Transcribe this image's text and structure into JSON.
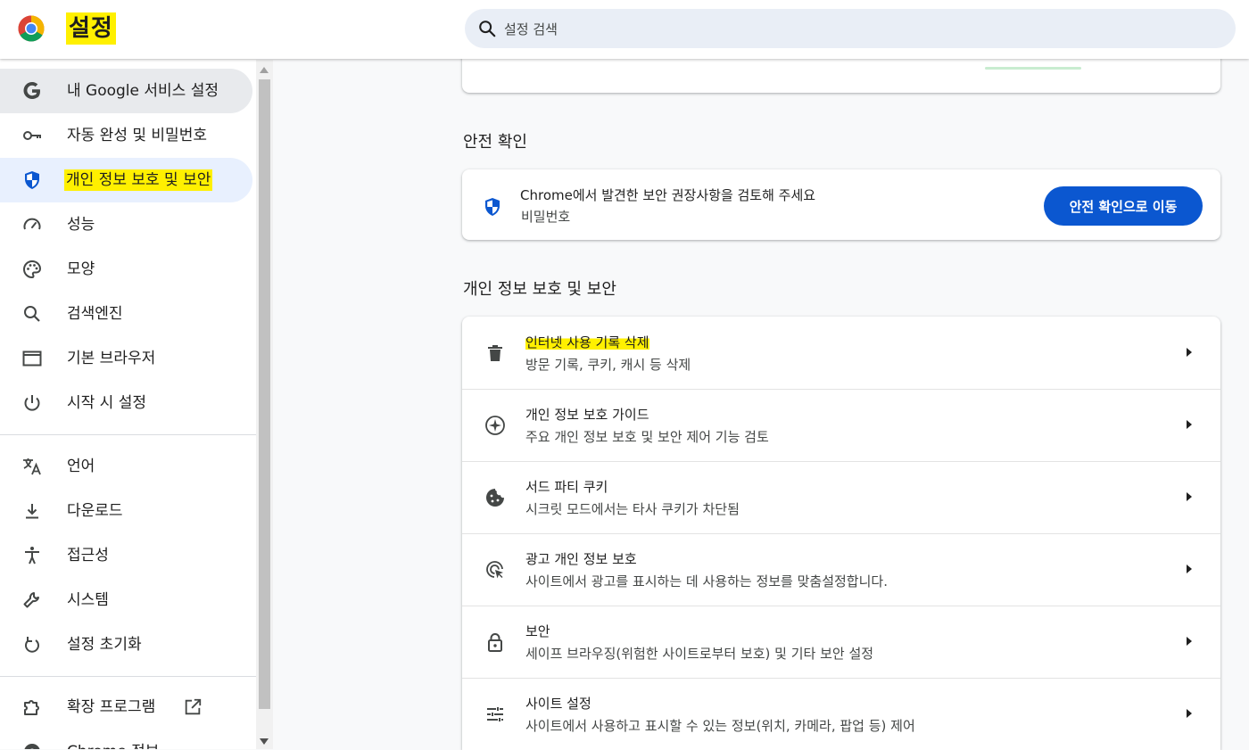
{
  "header": {
    "title": "설정",
    "search_placeholder": "설정 검색"
  },
  "sidebar": {
    "items": [
      {
        "label": "내 Google 서비스 설정",
        "icon": "google-g-icon"
      },
      {
        "label": "자동 완성 및 비밀번호",
        "icon": "key-icon"
      },
      {
        "label": "개인 정보 보호 및 보안",
        "icon": "shield-icon"
      },
      {
        "label": "성능",
        "icon": "speedometer-icon"
      },
      {
        "label": "모양",
        "icon": "palette-icon"
      },
      {
        "label": "검색엔진",
        "icon": "search-icon"
      },
      {
        "label": "기본 브라우저",
        "icon": "browser-window-icon"
      },
      {
        "label": "시작 시 설정",
        "icon": "power-icon"
      },
      {
        "label": "언어",
        "icon": "translate-icon"
      },
      {
        "label": "다운로드",
        "icon": "download-icon"
      },
      {
        "label": "접근성",
        "icon": "accessibility-icon"
      },
      {
        "label": "시스템",
        "icon": "wrench-icon"
      },
      {
        "label": "설정 초기화",
        "icon": "reset-icon"
      },
      {
        "label": "확장 프로그램",
        "icon": "extension-icon"
      },
      {
        "label": "Chrome 정보",
        "icon": "chrome-icon"
      }
    ]
  },
  "safety_check": {
    "section_title": "안전 확인",
    "primary": "Chrome에서 발견한 보안 권장사항을 검토해 주세요",
    "secondary": "비밀번호",
    "button_label": "안전 확인으로 이동"
  },
  "privacy": {
    "section_title": "개인 정보 보호 및 보안",
    "rows": [
      {
        "primary": "인터넷 사용 기록 삭제",
        "secondary": "방문 기록, 쿠키, 캐시 등 삭제",
        "icon": "trash-icon"
      },
      {
        "primary": "개인 정보 보호 가이드",
        "secondary": "주요 개인 정보 보호 및 보안 제어 기능 검토",
        "icon": "compass-icon"
      },
      {
        "primary": "서드 파티 쿠키",
        "secondary": "시크릿 모드에서는 타사 쿠키가 차단됨",
        "icon": "cookie-icon"
      },
      {
        "primary": "광고 개인 정보 보호",
        "secondary": "사이트에서 광고를 표시하는 데 사용하는 정보를 맞춤설정합니다.",
        "icon": "ad-privacy-icon"
      },
      {
        "primary": "보안",
        "secondary": "세이프 브라우징(위험한 사이트로부터 보호) 및 기타 보안 설정",
        "icon": "lock-icon"
      },
      {
        "primary": "사이트 설정",
        "secondary": "사이트에서 사용하고 표시할 수 있는 정보(위치, 카메라, 팝업 등) 제어",
        "icon": "tune-icon"
      }
    ]
  },
  "colors": {
    "accent": "#0b57d0",
    "highlight": "#fff000",
    "selected_nav": "#e8f0fe"
  }
}
